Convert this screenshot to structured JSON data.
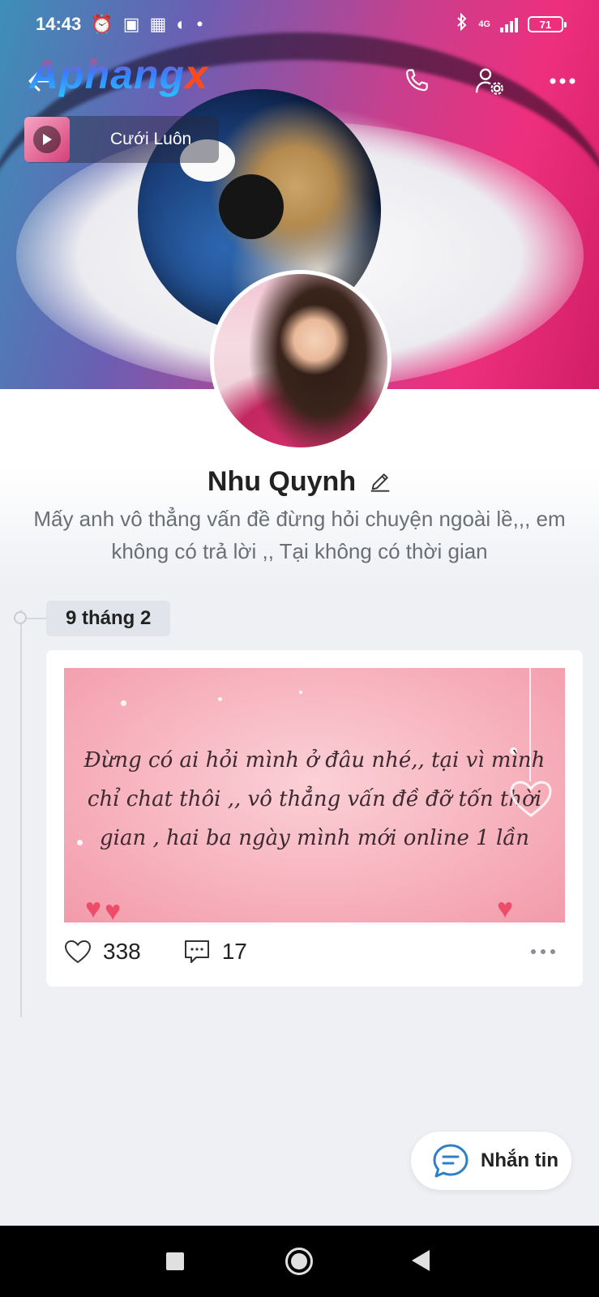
{
  "status_bar": {
    "time": "14:43",
    "network": "4G",
    "battery": "71"
  },
  "watermark": {
    "main": "Aphang",
    "suffix": "x"
  },
  "music": {
    "title": "Cưới Luôn"
  },
  "profile": {
    "name": "Nhu Quynh",
    "bio": "Mấy anh vô thẳng vấn đề đừng hỏi chuyện ngoài lề,,, em không có trả lời ,, Tại không có thời gian"
  },
  "timeline": {
    "date": "9 tháng 2"
  },
  "post": {
    "text": "Đừng có ai hỏi mình ở đâu nhé,, tại vì mình chỉ chat thôi ,, vô thẳng vấn đề đỡ tốn thời gian , hai ba ngày mình mới online 1 lần",
    "likes": "338",
    "comments": "17"
  },
  "message_button": {
    "label": "Nhắn tin"
  },
  "colors": {
    "accent": "#2f7fc8",
    "heart": "#ee4d6a"
  },
  "icons": [
    "back-arrow-icon",
    "phone-icon",
    "user-settings-icon",
    "more-icon",
    "play-icon",
    "edit-pencil-icon",
    "heart-icon",
    "comment-icon",
    "chat-bubble-icon"
  ]
}
